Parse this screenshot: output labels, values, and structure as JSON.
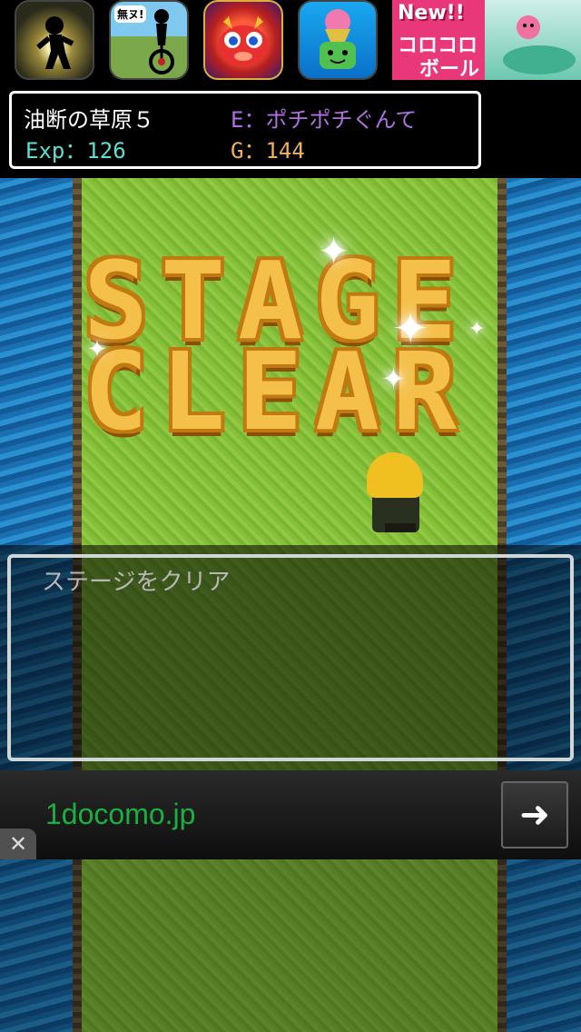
{
  "top_ads": {
    "new_ad": {
      "badge": "New!!",
      "line1": "コロコロ",
      "line2": "ボール"
    },
    "icon2_caption": "無ヌ!"
  },
  "status": {
    "stage_name": "油断の草原５",
    "enemy": "E：ポチポチぐんて",
    "exp": "Exp：126",
    "gold": "G：144"
  },
  "banner": {
    "line1": "STAGE",
    "line2": "CLEAR"
  },
  "message": {
    "text": "ステージをクリア"
  },
  "bottom_ad": {
    "text": "1docomo.jp",
    "arrow": "➜",
    "close": "✕"
  },
  "colors": {
    "exp": "#5be0d0",
    "gold": "#f0b060",
    "enemy": "#b070e0",
    "banner_fill": "#f4c04a",
    "ad_text": "#1ab040"
  },
  "icons": [
    "runner-app-icon",
    "unicycle-app-icon",
    "dragon-app-icon",
    "watering-can-app-icon",
    "arrow-right-icon",
    "close-icon",
    "sparkle-icon"
  ]
}
